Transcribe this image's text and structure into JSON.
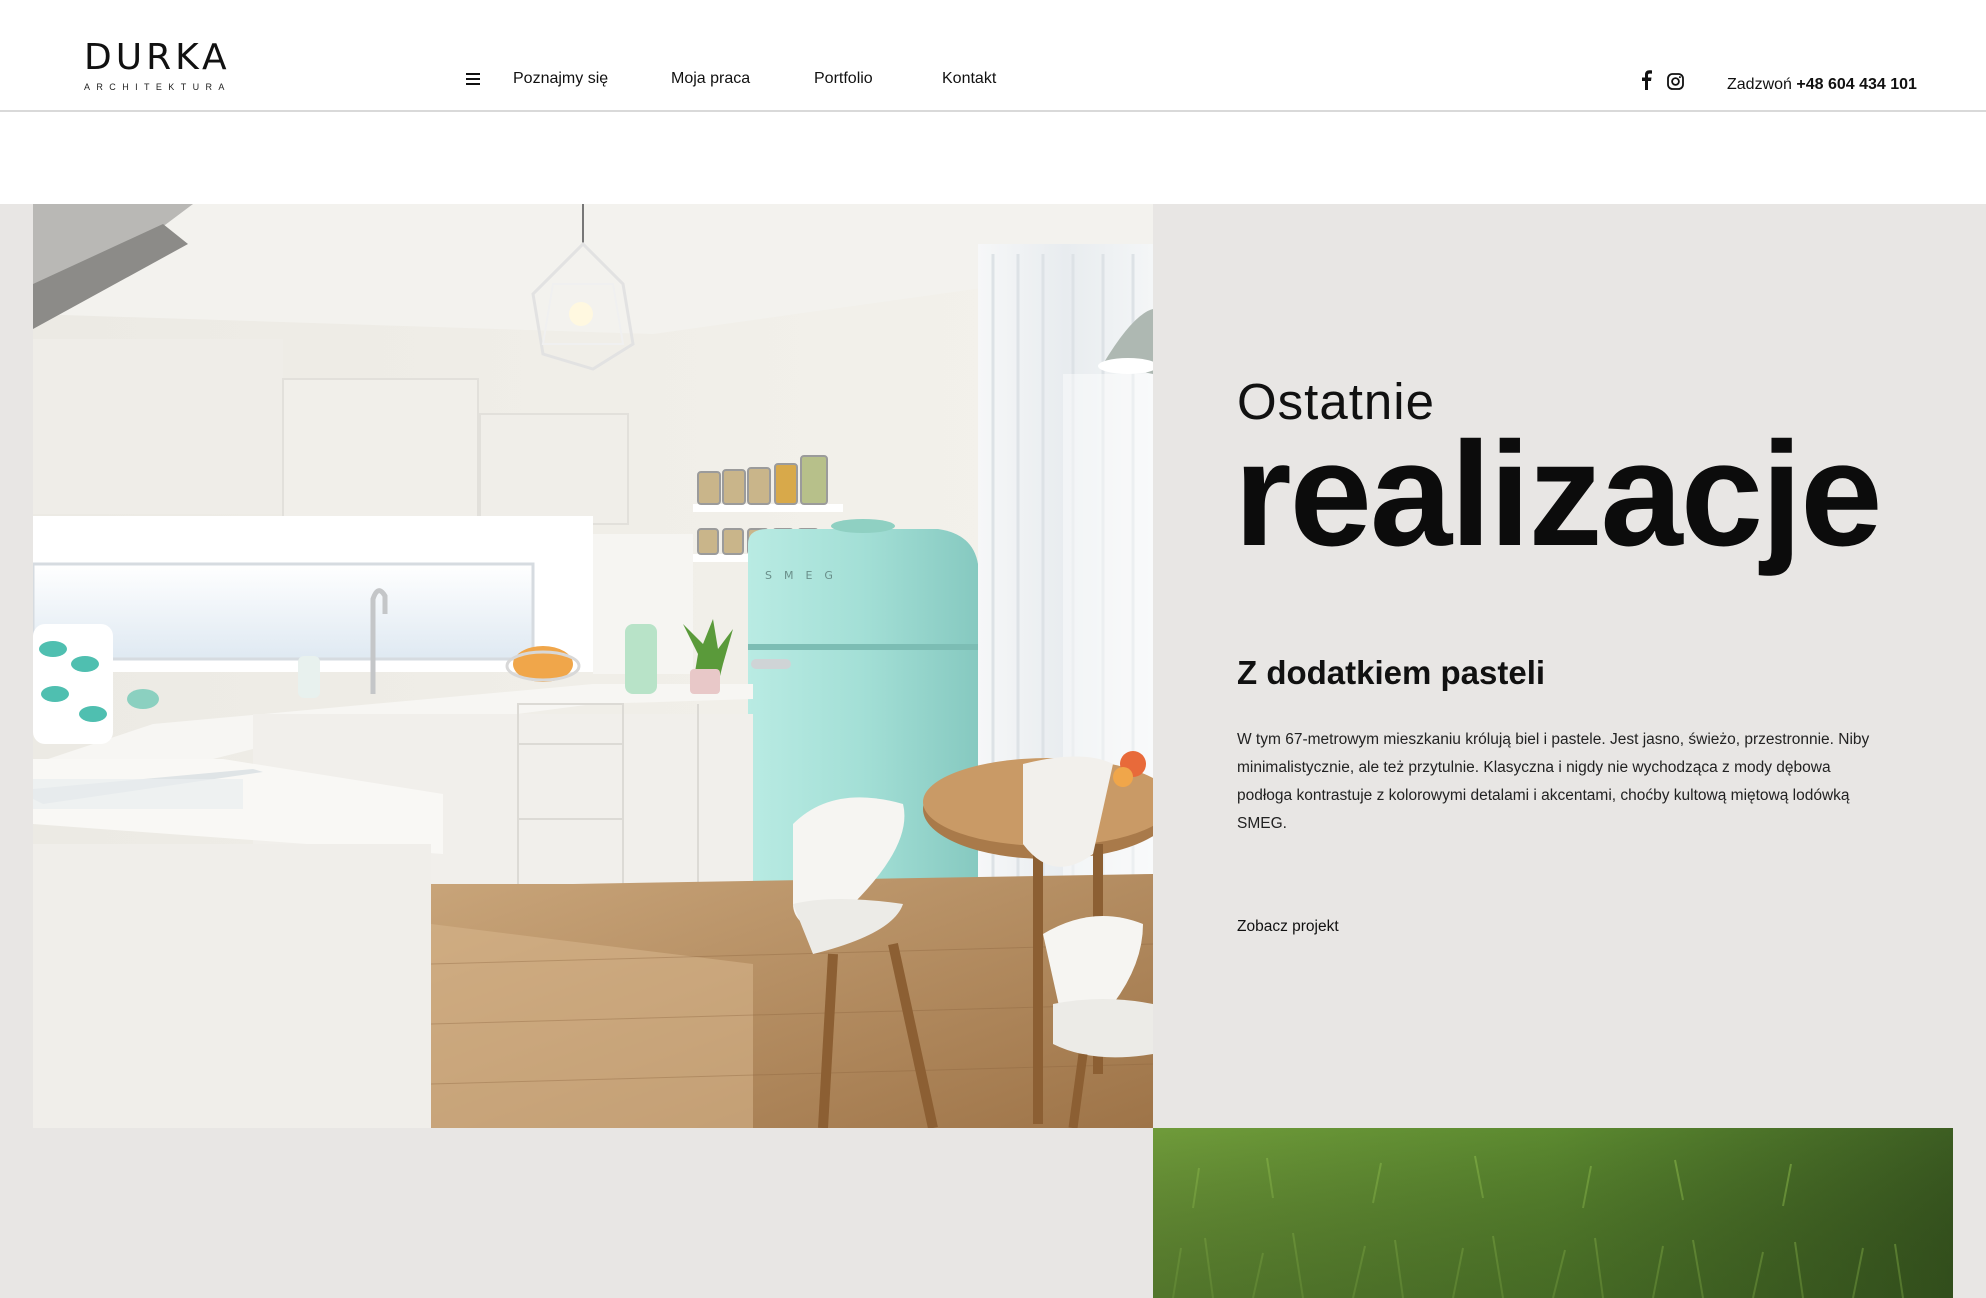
{
  "logo": {
    "word": "DURKA",
    "sub": "ARCHITEKTURA"
  },
  "nav": {
    "menu_icon": "hamburger-icon",
    "items": [
      {
        "label": "Poznajmy się"
      },
      {
        "label": "Moja praca"
      },
      {
        "label": "Portfolio"
      },
      {
        "label": "Kontakt"
      }
    ]
  },
  "social": {
    "facebook_icon": "facebook-icon",
    "instagram_icon": "instagram-icon"
  },
  "phone": {
    "prefix": "Zadzwoń",
    "number": "+48 604 434 101"
  },
  "hero": {
    "eyebrow": "Ostatnie",
    "headline": "realizacje",
    "project_title": "Z dodatkiem pasteli",
    "project_desc": "W tym 67-metrowym mieszkaniu królują biel i pastele. Jest jasno, świeżo, przestronnie. Niby minimalistycznie, ale też przytulnie. Klasyczna i nigdy nie wychodząca z mody dębowa podłoga kontrastuje z kolorowymi detalami i akcentami, choćby kultową miętową lodówką SMEG.",
    "link_label": "Zobacz projekt",
    "fridge_brand": "SMEG"
  },
  "colors": {
    "section_bg": "#e8e6e4",
    "fridge": "#a6e0d6",
    "floor": "#b48c5f",
    "grass": "#4f7a2a"
  }
}
